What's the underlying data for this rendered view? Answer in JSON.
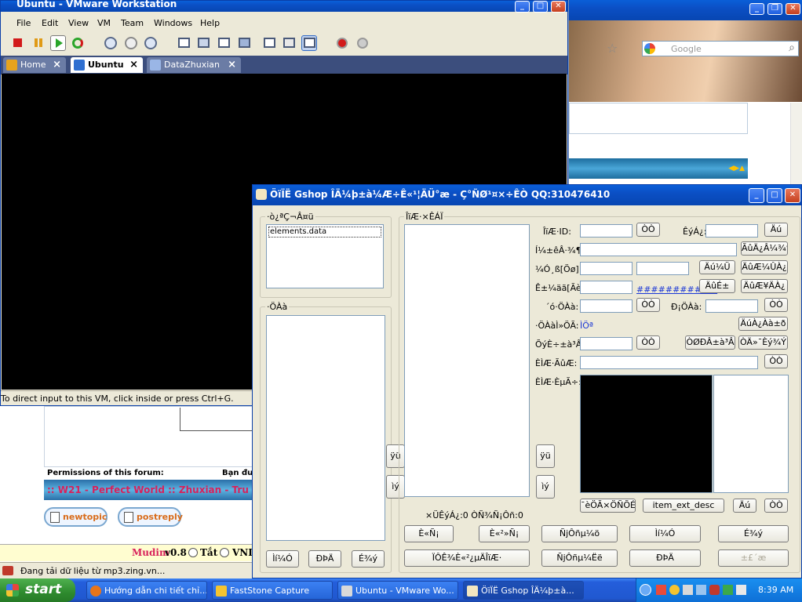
{
  "vmware": {
    "title": "Ubuntu - VMware Workstation",
    "menu": [
      "File",
      "Edit",
      "View",
      "VM",
      "Team",
      "Windows",
      "Help"
    ],
    "tabs": [
      {
        "label": "Home"
      },
      {
        "label": "Ubuntu"
      },
      {
        "label": "DataZhuxian"
      }
    ],
    "status_text": "To direct input to this VM, click inside or press Ctrl+G."
  },
  "browser": {
    "search_placeholder": "Google"
  },
  "forum": {
    "permissions_label": "Permissions of this forum:",
    "right_label": "Bạn đư",
    "banner_text": ":: W21 - Perfect World :: Zhuxian - Tru Ti",
    "newtopic": "newtopic",
    "postreply": "postreply",
    "mudim_name": "Mudim",
    "mudim_version": "v0.8",
    "radio1": "Tắt",
    "radio2": "VNI",
    "loading_text": "Đang tải dữ liệu từ mp3.zing.vn..."
  },
  "gshop": {
    "title": "ÖïÏË Gshop ÎÄ¼þ±à¼­Æ÷Ê«¹¦ÄÜ°æ - Ç°ÑØ¹¤×÷ÊÒ QQ:310476410",
    "group_files": "·ò¿ªÇ¬Â¤ü",
    "file_item": "elements.data",
    "group_category": "·ÖÀà",
    "group_items": "ÎïÆ·×ÊÁÏ",
    "btn_left1": "Ìí¼Ó",
    "btn_left2": "ÐÞÄ",
    "btn_left3": "É¾ý",
    "arrow_up": "ÿü",
    "arrow_down": "ìý",
    "id_label": "ÎïÆ·ID:",
    "id_btn": "ÒÒ",
    "price_label": "ÊýÁ¿:",
    "price_btn": "Äú",
    "name_label": "Í¼±êÂ·¾¶:",
    "name_btn": "ÃûÄ¿Â¼¾¶",
    "r3_label": "¼Ó¸ß[Öø]:",
    "r3_btn1": "Äú¼Ü",
    "r3_btn2": "ÄûÆ¼ÛÀ¿",
    "r4_label": "Ê±¼äã[Ãè]:",
    "r4_link": "##########天",
    "r4_btn1": "ÄûÉ±",
    "r4_btn2": "ÄûÆ¥ÄÀ¿",
    "r5_label": "´ó·ÖÀà:",
    "r5_btn": "ÒÒ",
    "r5_label2": "Ð¡ÖÀà:",
    "r5_btn2": "ÒÒ",
    "r6_label": "·ÖÀàÌ»ÖÃ:",
    "r6_value": "ÌÖª",
    "r6_btn": "ÄúÀ¿Àà±ð",
    "r7_label": "ÕýÈ÷±à³Â:",
    "r7_btn1": "ÒÒ",
    "r7_btn2": "ÒØÐÂ±à³Â",
    "r7_btn3": "ÒÄ»¯Èý¾Ý",
    "r8_label": "ÈÌÆ·ÃûÆ:",
    "r8_btn": "ÒÒ",
    "r9_label": "ÈÌÆ·ÈµÃ÷:",
    "bottom_btn1": "¯èÖÃ×ÖÑÕÉ«",
    "bottom_btn2": "item_ext_desc",
    "bottom_btn3": "Äú",
    "bottom_btn4": "ÒÒ",
    "count_label": "×ÜÊýÁ¿:0 ÒÑ¾­Ñ¡Ôñ:0",
    "row1": [
      "È«Ñ¡",
      "È«²»Ñ¡",
      "ÑjÔñµ¼ö",
      "Ìí¼Ó",
      "É¾ý"
    ],
    "row2": [
      "ÏÔÊ¾È«²¿µÄÎïÆ·",
      "ÑjÔñµ¼Ëë",
      "ÐÞÄ",
      "±£´æ"
    ]
  },
  "taskbar": {
    "start": "start",
    "items": [
      "Hướng dẫn chi tiết chỉ...",
      "FastStone Capture",
      "Ubuntu - VMware Wo...",
      "ÖïÏË Gshop ÎÄ¼þ±à..."
    ],
    "clock": "8:39 AM"
  }
}
